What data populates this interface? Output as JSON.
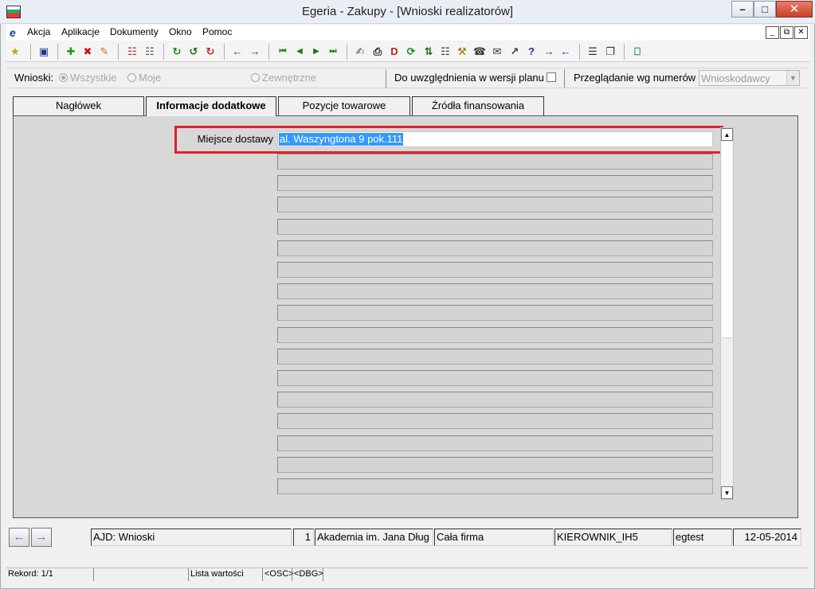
{
  "window": {
    "title": "Egeria - Zakupy - [Wnioski realizatorów]"
  },
  "menu": {
    "items": [
      "Akcja",
      "Aplikacje",
      "Dokumenty",
      "Okno",
      "Pomoc"
    ]
  },
  "filter": {
    "label": "Wnioski:",
    "options": [
      "Wszystkie",
      "Moje",
      "Zewnętrzne"
    ],
    "selected": "Wszystkie",
    "plan_label": "Do uwzględnienia w wersji planu",
    "sort_label": "Przeglądanie wg numerów",
    "sort_value": "Wnioskodawcy"
  },
  "tabs": [
    "Nagłówek",
    "Informacje dodatkowe",
    "Pozycje towarowe",
    "Źródła finansowania"
  ],
  "active_tab": "Informacje dodatkowe",
  "form": {
    "field_label": "Miejsce dostawy",
    "field_value": "al. Waszyngtona 9 pok.111"
  },
  "context_bar": {
    "module": "AJD: Wnioski",
    "count": "1",
    "organization": "Akademia im. Jana Dług",
    "scope": "Cała firma",
    "role": "KIEROWNIK_IH5",
    "user": "egtest",
    "date": "12-05-2014"
  },
  "status_bar": {
    "record": "Rekord: 1/1",
    "list": "Lista wartości",
    "osc": "<OSC>",
    "dbg": "<DBG>"
  }
}
